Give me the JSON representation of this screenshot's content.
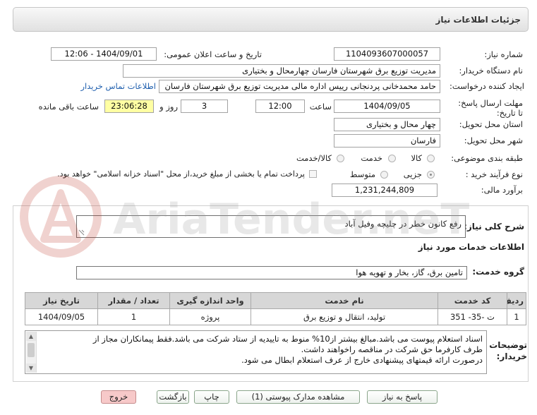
{
  "page": {
    "title": "جزئیات اطلاعات نیاز"
  },
  "watermark": {
    "text": "AriaTender.neT"
  },
  "fields": {
    "need_number": {
      "label": "شماره نیاز:",
      "value": "1104093607000057"
    },
    "announce_datetime": {
      "label": "تاریخ و ساعت اعلان عمومی:",
      "value": "1404/09/01 - 12:06"
    },
    "buyer_org": {
      "label": "نام دستگاه خریدار:",
      "value": "مدیریت توزیع برق شهرستان فارسان چهارمحال و بختیاری"
    },
    "requester": {
      "label": "ایجاد کننده درخواست:",
      "value": "حامد محمدخانی پردنجانی رییس اداره مالی مدیریت توزیع برق شهرستان فارسان",
      "contact_link": "اطلاعات تماس خریدار"
    },
    "deadline": {
      "label_line1": "مهلت ارسال پاسخ:",
      "label_line2": "تا تاریخ:",
      "date": "1404/09/05",
      "time_label": "ساعت",
      "time": "12:00",
      "days": "3",
      "days_label": "روز و",
      "remaining": "23:06:28",
      "remaining_label": "ساعت باقی مانده"
    },
    "delivery_province": {
      "label": "استان محل تحویل:",
      "value": "چهار محال و بختیاری"
    },
    "delivery_city": {
      "label": "شهر محل تحویل:",
      "value": "فارسان"
    },
    "category": {
      "label": "طبقه بندی موضوعی:",
      "options": [
        {
          "label": "کالا",
          "selected": false
        },
        {
          "label": "خدمت",
          "selected": false
        },
        {
          "label": "کالا/خدمت",
          "selected": false
        }
      ]
    },
    "purchase_process": {
      "label": "نوع فرآیند خرید :",
      "options": [
        {
          "label": "جزیی",
          "selected": true
        },
        {
          "label": "متوسط",
          "selected": false
        }
      ],
      "treasury_option": {
        "label": "پرداخت تمام یا بخشی از مبلغ خرید،از محل \"اسناد خزانه اسلامی\" خواهد بود.",
        "checked": false
      }
    },
    "estimate": {
      "label": "برآورد مالی:",
      "value": "1,231,244,809"
    }
  },
  "description": {
    "label": "شرح کلی نیاز:",
    "value": "رفع کانون خطر در چلیچه وفیل آباد"
  },
  "services": {
    "heading": "اطلاعات خدمات مورد نیاز",
    "group_label": "گروه خدمت:",
    "group_value": "تامین برق، گاز، بخار و تهویه هوا",
    "table": {
      "headers": [
        "ردیف",
        "کد خدمت",
        "نام خدمت",
        "واحد اندازه گیری",
        "تعداد / مقدار",
        "تاریخ نیاز"
      ],
      "rows": [
        [
          "1",
          "ت -35- 351",
          "تولید، انتقال و توزیع برق",
          "پروژه",
          "1",
          "1404/09/05"
        ]
      ]
    }
  },
  "buyer_notes": {
    "label": "توضیحات خریدار:",
    "lines": [
      "اسناد استعلام پیوست می باشد.مبالغ بیشتر از10% منوط به تاییدیه از ستاد شرکت می باشد.فقط پیمانکاران مجاز از",
      "طرف کارفرما حق شرکت در مناقصه راخواهند داشت.",
      "درصورت ارائه قیمتهای پیشنهادی خارج از عرف استعلام ابطال می شود."
    ]
  },
  "buttons": {
    "respond": "پاسخ به نیاز",
    "attachments": "مشاهده مدارک پیوستی (1)",
    "print": "چاپ",
    "back": "بازگشت",
    "exit": "خروج"
  },
  "icons": {
    "textarea_resize": "resize-handle-icon",
    "scroll_up": "scroll-up-arrow-icon",
    "scroll_down": "scroll-down-arrow-icon",
    "watermark_logo": "ariatender-logo"
  },
  "colors": {
    "link": "#1f5fae",
    "remaining_highlight": "#ffffa3",
    "exit_button": "#f7c9c9",
    "table_header": "#d7d7d7"
  }
}
